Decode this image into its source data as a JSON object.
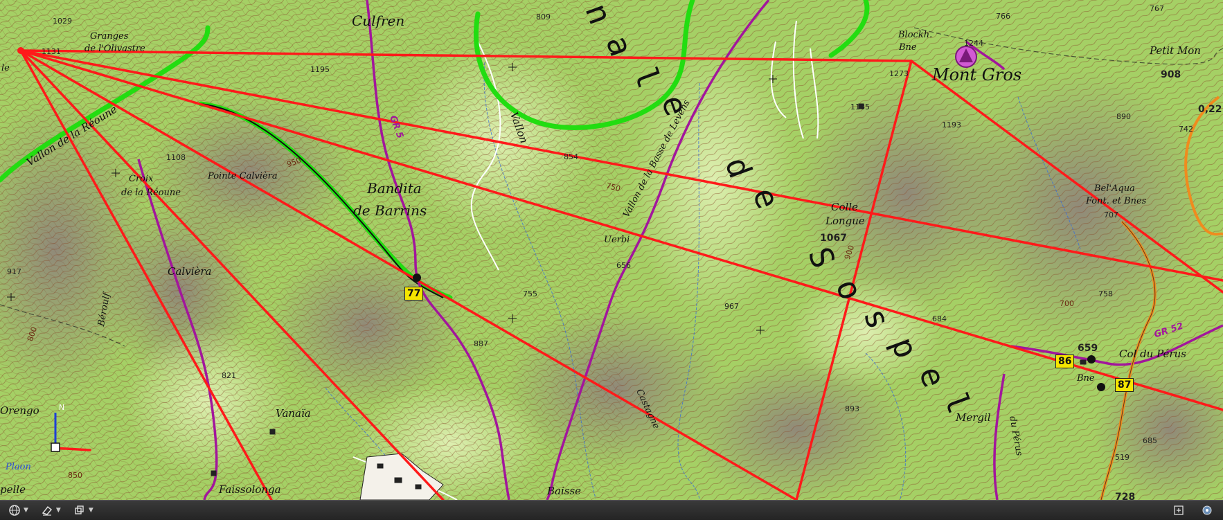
{
  "map": {
    "colors": {
      "terrain": "#a8d46a",
      "terrain_light": "#cfe89a",
      "shadow": "#9a8a88",
      "contour": "#8a4a2a",
      "route": "#ff1a1a",
      "forest_track": "#22dd11",
      "trail": "#a2169c",
      "road": "#f08b1e",
      "water": "#3a6fd8"
    },
    "place_names": {
      "culfren": "Culfren",
      "granges": "Granges",
      "olivastre": "de l'Olivastre",
      "vallon_de_la_reoune": "Vallon de la Réoune",
      "reoune": "Réoune",
      "pointe_calviera": "Pointe Calvièra",
      "croix": "Croix",
      "de_la_reoune": "de la Réoune",
      "bandita": "Bandita",
      "de_barrins": "de Barrins",
      "calviera": "Calvièra",
      "beroulf": "Béroulf",
      "vallon": "Vallon",
      "vallon_de_la_basse": "Vallon de la Basse de Levens",
      "colle": "Colle",
      "longue": "Longue",
      "blockh": "Blockh.",
      "bne": "Bne",
      "mont_gros": "Mont Gros",
      "petit_mon": "Petit Mon",
      "bel_aqua": "Bel'Aqua",
      "font_bnes": "Font. et Bnes",
      "col_du_perus": "Col du Pérus",
      "bne_2": "Bne",
      "mergil": "Mergil",
      "castagne": "Castagne",
      "orengo": "Orengo",
      "vanaia": "Vanaïa",
      "plaon": "Plaon",
      "pelle": "pelle",
      "faissolonga": "Faissolonga",
      "baisse": "Baisse",
      "ue": "Ue",
      "de": "de",
      "ue_b": "Uerbi",
      "vallon_2": "Vallon",
      "du_perus": "du Pérus",
      "bandita_region": "Bandita de Sospel",
      "le": "le"
    },
    "region_letters": [
      "n",
      "a",
      "l",
      "e",
      "d",
      "e",
      "S",
      "o",
      "s",
      "p",
      "e",
      "l"
    ],
    "elevations": {
      "e1029": "1029",
      "e1195": "1195",
      "e1108": "1108",
      "e917": "917",
      "e821": "821",
      "e809": "809",
      "e854": "854",
      "e656": "656",
      "e755": "755",
      "e887": "887",
      "e1067": "1067",
      "e967": "967",
      "e893": "893",
      "e684": "684",
      "e1185": "1185",
      "e1273": "1273",
      "e1244": "1244",
      "e1193": "1193",
      "e766": "766",
      "e767": "767",
      "e908": "908",
      "e890": "890",
      "e742": "742",
      "e707": "707",
      "e758": "758",
      "e659": "659",
      "e519": "519",
      "e685": "685",
      "e728": "728",
      "e0_22": "0,22",
      "e1131": "1131",
      "c950": "950",
      "c750": "750",
      "c900": "900",
      "c800": "800",
      "c700": "700",
      "c850": "850"
    },
    "waypoints": {
      "wp77": "77",
      "wp86": "86",
      "wp87": "87"
    },
    "trail_labels": {
      "gr52": "GR 52",
      "gr_left": "GR 5"
    },
    "compass": {
      "north": "N"
    }
  },
  "toolbar": {
    "buttons": [
      {
        "icon": "globe-icon"
      },
      {
        "icon": "eraser-icon"
      },
      {
        "icon": "layers-icon"
      }
    ],
    "right_buttons": [
      {
        "icon": "add-window-icon"
      },
      {
        "icon": "gps-icon"
      }
    ]
  }
}
